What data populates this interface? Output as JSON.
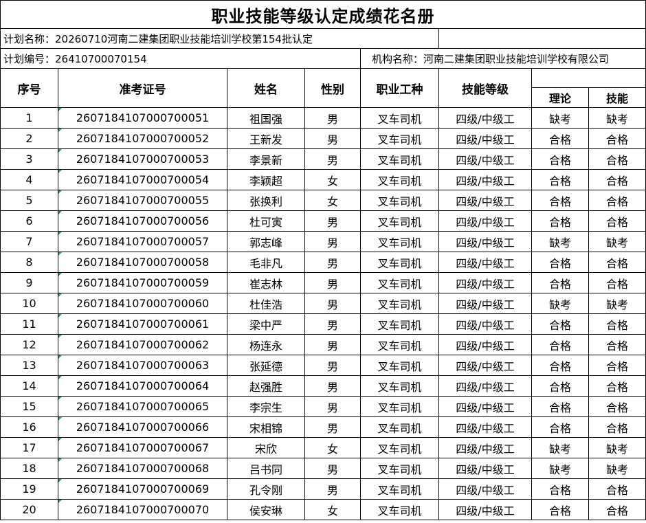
{
  "title": "职业技能等级认定成绩花名册",
  "plan_name": "计划名称：20260710河南二建集团职业技能培训学校第154批认定",
  "plan_number": "计划编号：26410700070154",
  "org_name": "机构名称：河南二建集团职业技能培训学校有限公司",
  "headers": {
    "seq": "序号",
    "exam_id": "准考证号",
    "name": "姓名",
    "gender": "性别",
    "job": "职业工种",
    "level": "技能等级",
    "theory": "理论",
    "skill": "技能"
  },
  "rows": [
    {
      "seq": "1",
      "exam_id": "2607184107000700051",
      "name": "祖国强",
      "gender": "男",
      "job": "叉车司机",
      "level": "四级/中级工",
      "theory": "缺考",
      "skill": "缺考"
    },
    {
      "seq": "2",
      "exam_id": "2607184107000700052",
      "name": "王新发",
      "gender": "男",
      "job": "叉车司机",
      "level": "四级/中级工",
      "theory": "合格",
      "skill": "合格"
    },
    {
      "seq": "3",
      "exam_id": "2607184107000700053",
      "name": "李景新",
      "gender": "男",
      "job": "叉车司机",
      "level": "四级/中级工",
      "theory": "合格",
      "skill": "合格"
    },
    {
      "seq": "4",
      "exam_id": "2607184107000700054",
      "name": "李颖超",
      "gender": "女",
      "job": "叉车司机",
      "level": "四级/中级工",
      "theory": "合格",
      "skill": "合格"
    },
    {
      "seq": "5",
      "exam_id": "2607184107000700055",
      "name": "张换利",
      "gender": "女",
      "job": "叉车司机",
      "level": "四级/中级工",
      "theory": "合格",
      "skill": "合格"
    },
    {
      "seq": "6",
      "exam_id": "2607184107000700056",
      "name": "杜可寅",
      "gender": "男",
      "job": "叉车司机",
      "level": "四级/中级工",
      "theory": "合格",
      "skill": "合格"
    },
    {
      "seq": "7",
      "exam_id": "2607184107000700057",
      "name": "郭志峰",
      "gender": "男",
      "job": "叉车司机",
      "level": "四级/中级工",
      "theory": "缺考",
      "skill": "缺考"
    },
    {
      "seq": "8",
      "exam_id": "2607184107000700058",
      "name": "毛非凡",
      "gender": "男",
      "job": "叉车司机",
      "level": "四级/中级工",
      "theory": "合格",
      "skill": "合格"
    },
    {
      "seq": "9",
      "exam_id": "2607184107000700059",
      "name": "崔志林",
      "gender": "男",
      "job": "叉车司机",
      "level": "四级/中级工",
      "theory": "合格",
      "skill": "合格"
    },
    {
      "seq": "10",
      "exam_id": "2607184107000700060",
      "name": "杜佳浩",
      "gender": "男",
      "job": "叉车司机",
      "level": "四级/中级工",
      "theory": "缺考",
      "skill": "缺考"
    },
    {
      "seq": "11",
      "exam_id": "2607184107000700061",
      "name": "梁中严",
      "gender": "男",
      "job": "叉车司机",
      "level": "四级/中级工",
      "theory": "合格",
      "skill": "合格"
    },
    {
      "seq": "12",
      "exam_id": "2607184107000700062",
      "name": "杨连永",
      "gender": "男",
      "job": "叉车司机",
      "level": "四级/中级工",
      "theory": "合格",
      "skill": "合格"
    },
    {
      "seq": "13",
      "exam_id": "2607184107000700063",
      "name": "张延德",
      "gender": "男",
      "job": "叉车司机",
      "level": "四级/中级工",
      "theory": "合格",
      "skill": "合格"
    },
    {
      "seq": "14",
      "exam_id": "2607184107000700064",
      "name": "赵强胜",
      "gender": "男",
      "job": "叉车司机",
      "level": "四级/中级工",
      "theory": "合格",
      "skill": "合格"
    },
    {
      "seq": "15",
      "exam_id": "2607184107000700065",
      "name": "李宗生",
      "gender": "男",
      "job": "叉车司机",
      "level": "四级/中级工",
      "theory": "合格",
      "skill": "合格"
    },
    {
      "seq": "16",
      "exam_id": "2607184107000700066",
      "name": "宋相锦",
      "gender": "男",
      "job": "叉车司机",
      "level": "四级/中级工",
      "theory": "合格",
      "skill": "合格"
    },
    {
      "seq": "17",
      "exam_id": "2607184107000700067",
      "name": "宋欣",
      "gender": "女",
      "job": "叉车司机",
      "level": "四级/中级工",
      "theory": "缺考",
      "skill": "缺考"
    },
    {
      "seq": "18",
      "exam_id": "2607184107000700068",
      "name": "吕书同",
      "gender": "男",
      "job": "叉车司机",
      "level": "四级/中级工",
      "theory": "缺考",
      "skill": "缺考"
    },
    {
      "seq": "19",
      "exam_id": "2607184107000700069",
      "name": "孔令刚",
      "gender": "男",
      "job": "叉车司机",
      "level": "四级/中级工",
      "theory": "合格",
      "skill": "合格"
    },
    {
      "seq": "20",
      "exam_id": "2607184107000700070",
      "name": "侯安琳",
      "gender": "女",
      "job": "叉车司机",
      "level": "四级/中级工",
      "theory": "合格",
      "skill": "合格"
    }
  ]
}
